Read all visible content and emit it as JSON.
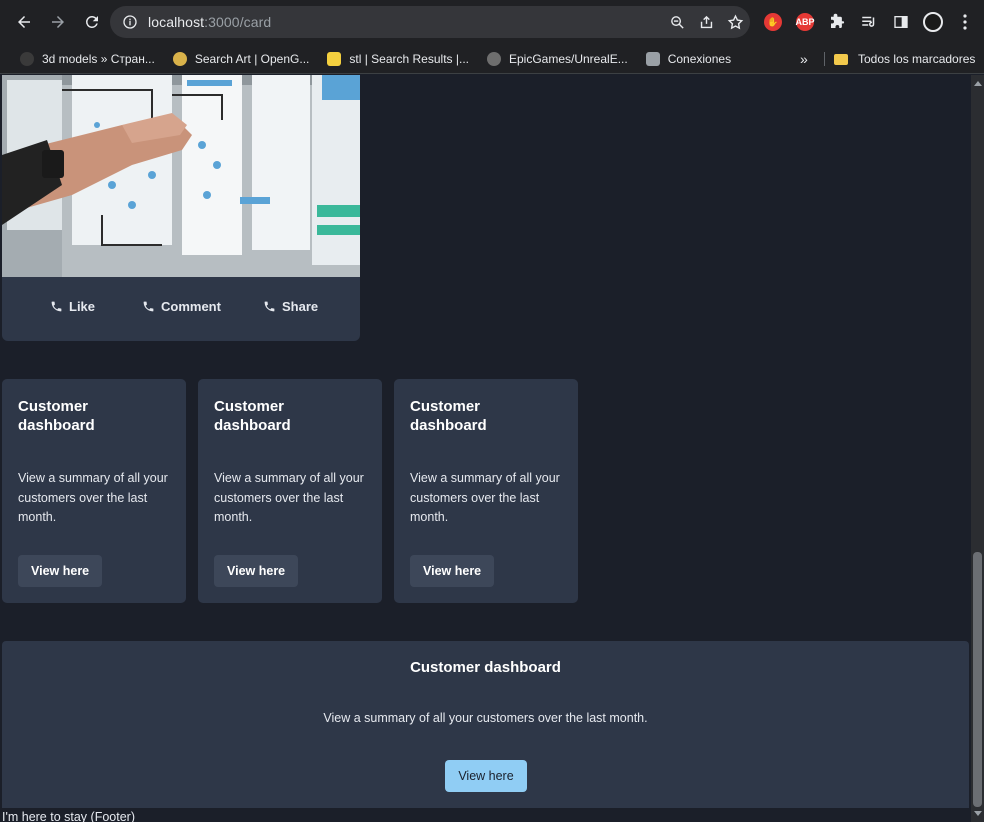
{
  "browser": {
    "url_host": "localhost",
    "url_path": ":3000/card",
    "bookmarks": [
      {
        "label": "3d models » Стран...",
        "color": "#3a3a3a"
      },
      {
        "label": "Search Art | OpenG...",
        "color": "#d9b24a"
      },
      {
        "label": "stl | Search Results |...",
        "color": "#f4d03f"
      },
      {
        "label": "EpicGames/UnrealE...",
        "color": "#6e6e6e"
      },
      {
        "label": "Conexiones",
        "color": "#9aa0a6"
      }
    ],
    "all_bookmarks_label": "Todos los marcadores",
    "more_label": "»",
    "extensions": {
      "abp_label": "ABP"
    }
  },
  "media_card": {
    "actions": [
      {
        "label": "Like"
      },
      {
        "label": "Comment"
      },
      {
        "label": "Share"
      }
    ]
  },
  "cards": [
    {
      "title": "Customer dashboard",
      "text": "View a summary of all your customers over the last month.",
      "button": "View here"
    },
    {
      "title": "Customer dashboard",
      "text": "View a summary of all your customers over the last month.",
      "button": "View here"
    },
    {
      "title": "Customer dashboard",
      "text": "View a summary of all your customers over the last month.",
      "button": "View here"
    }
  ],
  "wide_card": {
    "title": "Customer dashboard",
    "text": "View a summary of all your customers over the last month.",
    "button": "View here"
  },
  "footer": {
    "text": "I'm here to stay (Footer)"
  },
  "colors": {
    "background": "#1b1f29",
    "card": "#2e3748",
    "accent_button": "#90cdf4"
  }
}
